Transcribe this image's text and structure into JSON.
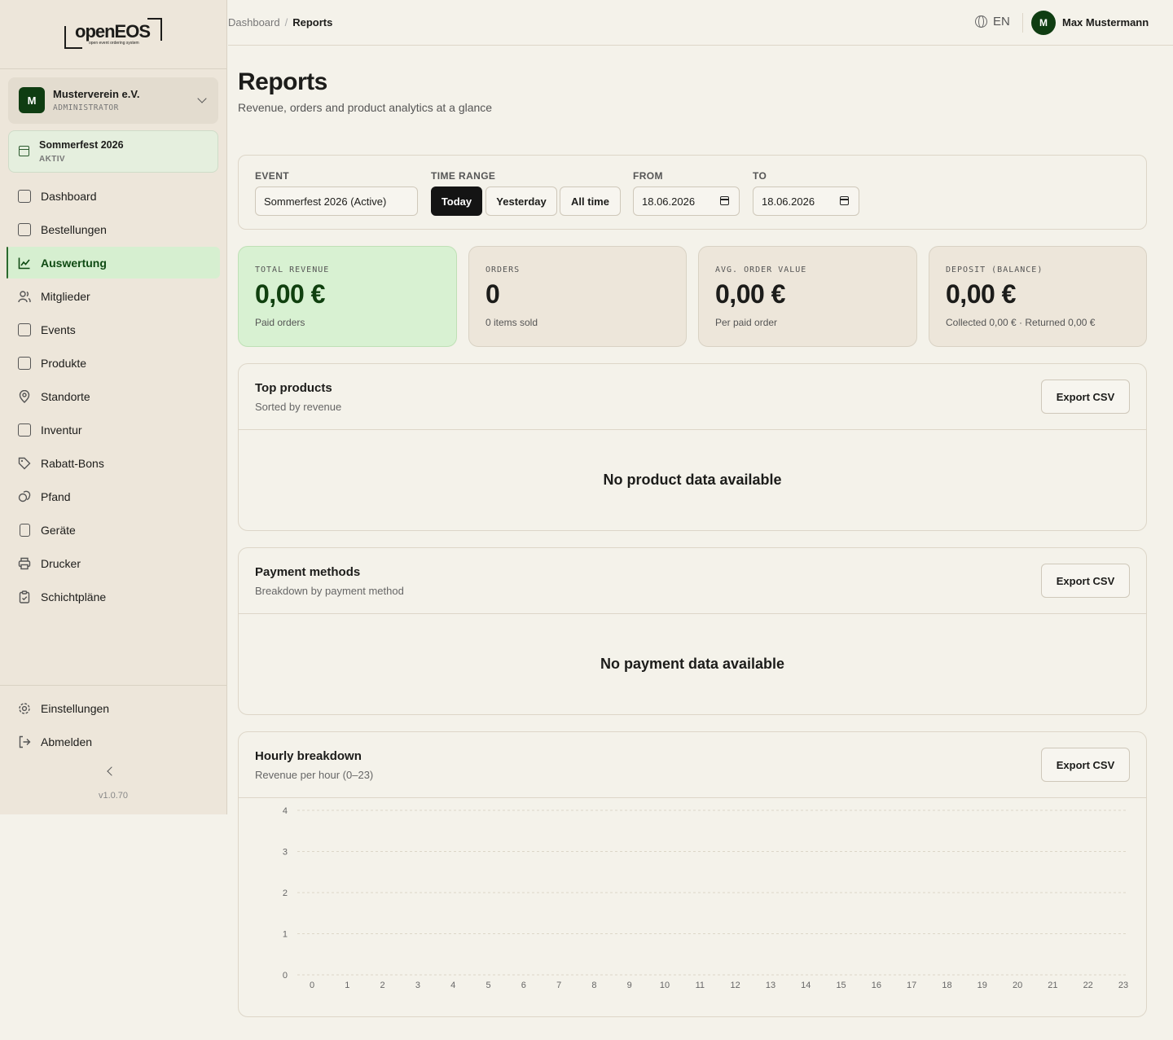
{
  "sidebar": {
    "logo_text": "openEOS",
    "logo_tagline": "open event ordering system",
    "org": {
      "initial": "M",
      "name": "Musterverein e.V.",
      "role": "ADMINISTRATOR"
    },
    "event": {
      "name": "Sommerfest 2026",
      "status": "AKTIV"
    },
    "items": [
      {
        "label": "Dashboard",
        "icon": "chart-box-icon"
      },
      {
        "label": "Bestellungen",
        "icon": "receipt-icon"
      },
      {
        "label": "Auswertung",
        "icon": "line-chart-icon",
        "active": true
      },
      {
        "label": "Mitglieder",
        "icon": "users-icon"
      },
      {
        "label": "Events",
        "icon": "calendar-icon"
      },
      {
        "label": "Produkte",
        "icon": "shopping-bag-icon"
      },
      {
        "label": "Standorte",
        "icon": "map-pin-icon"
      },
      {
        "label": "Inventur",
        "icon": "package-search-icon"
      },
      {
        "label": "Rabatt-Bons",
        "icon": "tag-icon"
      },
      {
        "label": "Pfand",
        "icon": "coins-icon"
      },
      {
        "label": "Geräte",
        "icon": "tablet-icon"
      },
      {
        "label": "Drucker",
        "icon": "printer-icon"
      },
      {
        "label": "Schichtpläne",
        "icon": "clipboard-check-icon"
      }
    ],
    "settings_label": "Einstellungen",
    "logout_label": "Abmelden",
    "version": "v1.0.70"
  },
  "header": {
    "breadcrumb_root": "Dashboard",
    "breadcrumb_sep": "/",
    "breadcrumb_current": "Reports",
    "language": "EN",
    "user_initial": "M",
    "user_name": "Max Mustermann"
  },
  "page": {
    "title": "Reports",
    "subtitle": "Revenue, orders and product analytics at a glance"
  },
  "filters": {
    "event_label": "EVENT",
    "event_value": "Sommerfest 2026 (Active)",
    "range_label": "TIME RANGE",
    "range_options": [
      "Today",
      "Yesterday",
      "All time"
    ],
    "range_selected": "Today",
    "from_label": "FROM",
    "from_value": "18.06.2026",
    "to_label": "TO",
    "to_value": "18.06.2026"
  },
  "kpis": [
    {
      "label": "TOTAL REVENUE",
      "value": "0,00 €",
      "sub": "Paid orders"
    },
    {
      "label": "ORDERS",
      "value": "0",
      "sub": "0 items sold"
    },
    {
      "label": "AVG. ORDER VALUE",
      "value": "0,00 €",
      "sub": "Per paid order"
    },
    {
      "label": "DEPOSIT (BALANCE)",
      "value": "0,00 €",
      "sub": "Collected 0,00 € · Returned 0,00 €"
    }
  ],
  "top_products": {
    "title": "Top products",
    "subtitle": "Sorted by revenue",
    "export_label": "Export CSV",
    "empty": "No product data available"
  },
  "payment_methods": {
    "title": "Payment methods",
    "subtitle": "Breakdown by payment method",
    "export_label": "Export CSV",
    "empty": "No payment data available"
  },
  "hourly": {
    "title": "Hourly breakdown",
    "subtitle": "Revenue per hour (0–23)",
    "export_label": "Export CSV"
  },
  "chart_data": {
    "type": "bar",
    "title": "",
    "xlabel": "",
    "ylabel": "",
    "categories": [
      "0",
      "1",
      "2",
      "3",
      "4",
      "5",
      "6",
      "7",
      "8",
      "9",
      "10",
      "11",
      "12",
      "13",
      "14",
      "15",
      "16",
      "17",
      "18",
      "19",
      "20",
      "21",
      "22",
      "23"
    ],
    "values": [
      0,
      0,
      0,
      0,
      0,
      0,
      0,
      0,
      0,
      0,
      0,
      0,
      0,
      0,
      0,
      0,
      0,
      0,
      0,
      0,
      0,
      0,
      0,
      0
    ],
    "y_ticks": [
      "0",
      "1",
      "2",
      "3",
      "4"
    ],
    "ylim": [
      0,
      4
    ],
    "grid": true
  },
  "colors": {
    "accent": "#0f3d12",
    "active_bg": "#d6efd0",
    "highlight_card": "#d8f1d2",
    "background": "#f4f2ea"
  }
}
